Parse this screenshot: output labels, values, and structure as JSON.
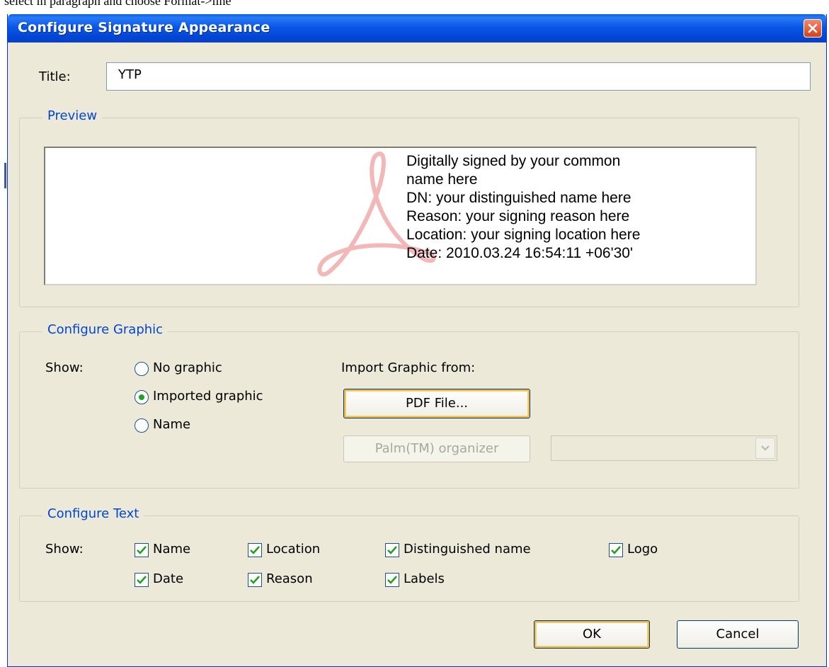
{
  "document": {
    "snippet": "select in paragraph and choose Format->line"
  },
  "dialog": {
    "title": "Configure Signature Appearance",
    "close_icon": "close-x-icon"
  },
  "title_field": {
    "label": "Title:",
    "value": "YTP"
  },
  "preview": {
    "legend": "Preview",
    "lines": [
      "Digitally signed by your common",
      "name here",
      "DN: your distinguished name here",
      "Reason: your signing reason here",
      "Location: your signing location here",
      "Date: 2010.03.24 16:54:11 +06'30'"
    ],
    "logo_icon": "adobe-acrobat-logo-watermark"
  },
  "configure_graphic": {
    "legend": "Configure Graphic",
    "show_label": "Show:",
    "options": [
      {
        "label": "No graphic",
        "selected": false
      },
      {
        "label": "Imported graphic",
        "selected": true
      },
      {
        "label": "Name",
        "selected": false
      }
    ],
    "import_label": "Import Graphic from:",
    "pdf_button": "PDF File...",
    "palm_button": "Palm(TM) organizer",
    "palm_select_value": ""
  },
  "configure_text": {
    "legend": "Configure Text",
    "show_label": "Show:",
    "checkboxes": [
      {
        "label": "Name",
        "checked": true
      },
      {
        "label": "Location",
        "checked": true
      },
      {
        "label": "Distinguished name",
        "checked": true
      },
      {
        "label": "Logo",
        "checked": true
      },
      {
        "label": "Date",
        "checked": true
      },
      {
        "label": "Reason",
        "checked": true
      },
      {
        "label": "Labels",
        "checked": true
      }
    ]
  },
  "buttons": {
    "ok": "OK",
    "cancel": "Cancel"
  },
  "colors": {
    "titlebar": "#0a58e6",
    "dialog_bg": "#ece9d8",
    "legend_text": "#0046d5",
    "check_mark": "#21a121",
    "logo_watermark": "#f3b7b7"
  }
}
